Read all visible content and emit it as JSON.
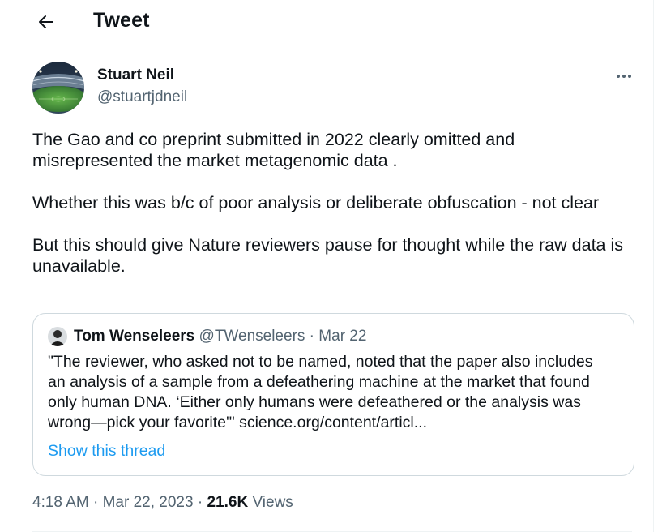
{
  "header": {
    "title": "Tweet",
    "back_icon": "arrow-left-icon"
  },
  "author": {
    "name": "Stuart Neil",
    "handle": "@stuartjdneil",
    "avatar": "stadium-photo-avatar",
    "more_icon": "more-horizontal-icon"
  },
  "tweet": {
    "paragraphs": [
      "The Gao and co preprint submitted in 2022 clearly omitted and misrepresented the market metagenomic data .",
      "Whether this was b/c of poor analysis or deliberate obfuscation - not clear",
      "But this should give Nature reviewers pause for thought while the raw data is unavailable."
    ]
  },
  "quote": {
    "name": "Tom Wenseleers",
    "handle": "@TWenseleers",
    "separator": " · ",
    "date": "Mar 22",
    "lines": [
      "\"The reviewer, who asked not to be named, noted that the paper also includes",
      "an analysis of a sample from a defeathering machine at the market that found",
      "only human DNA. ‘Either only humans were defeathered or the analysis was",
      "wrong—pick your favorite'\" science.org/content/articl..."
    ],
    "show_thread": "Show this thread"
  },
  "meta": {
    "time": "4:18 AM",
    "dot": " · ",
    "date": "Mar 22, 2023",
    "views_count": "21.6K",
    "views_label": "Views"
  },
  "colors": {
    "text": "#0f1419",
    "secondary": "#536471",
    "link": "#1d9bf0",
    "border": "#cfd9de"
  }
}
